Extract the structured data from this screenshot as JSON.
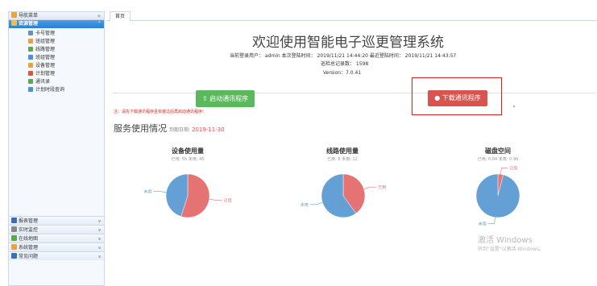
{
  "sidebar": {
    "header": "导航菜单",
    "active_group": "资源管理",
    "items": [
      {
        "label": "卡号管理",
        "color": "#6e8fbf"
      },
      {
        "label": "班组管理",
        "color": "#e8a33c"
      },
      {
        "label": "线路管理",
        "color": "#5ca84e"
      },
      {
        "label": "班组管理",
        "color": "#4f8fd6"
      },
      {
        "label": "设备管理",
        "color": "#e8a33c"
      },
      {
        "label": "计划管理",
        "color": "#d9534f"
      },
      {
        "label": "通讯录",
        "color": "#5ca84e"
      },
      {
        "label": "计划时段查询",
        "color": "#4f8fd6"
      }
    ],
    "bottom": [
      {
        "label": "报表管理",
        "color": "#3b6fb5"
      },
      {
        "label": "实时监控",
        "color": "#888888"
      },
      {
        "label": "在线地图",
        "color": "#5ca84e"
      },
      {
        "label": "系统管理",
        "color": "#e8a33c"
      },
      {
        "label": "常见问题",
        "color": "#3b6fb5"
      }
    ]
  },
  "tab": {
    "label": "首页"
  },
  "header": {
    "title": "欢迎使用智能电子巡更管理系统",
    "user_line": "当前登录用户： admin    本次登陆时间： 2019/11/21 14:44:20    最近登陆时间： 2019/11/21 14:43:57",
    "records_line": "巡检总记录数： 1598",
    "version_line": "Version：7.0.41"
  },
  "buttons": {
    "start": "启动通讯程序",
    "download": "下载通讯程序"
  },
  "note": "注：请先下载通讯程序且安装过后再启动通讯程序!",
  "section": {
    "title": "服务使用情况",
    "deadline_label": "到期日期:",
    "deadline_value": "2019-11-30"
  },
  "chart_data": [
    {
      "type": "pie",
      "title": "设备使用量",
      "subtitle": "已用: 55 未用: 45",
      "slices": [
        {
          "name": "已用",
          "value": 55,
          "color": "#e57373"
        },
        {
          "name": "未用",
          "value": 45,
          "color": "#64a0d6"
        }
      ]
    },
    {
      "type": "pie",
      "title": "线路使用量",
      "subtitle": "已用: 8 未用: 12",
      "slices": [
        {
          "name": "已用",
          "value": 8,
          "color": "#e57373"
        },
        {
          "name": "未用",
          "value": 12,
          "color": "#64a0d6"
        }
      ]
    },
    {
      "type": "pie",
      "title": "磁盘空间",
      "subtitle": "已用: 0.04 未用: 0.96",
      "slices": [
        {
          "name": "已用",
          "value": 0.04,
          "color": "#e57373"
        },
        {
          "name": "未用",
          "value": 0.96,
          "color": "#64a0d6"
        }
      ]
    }
  ],
  "watermark": {
    "line1": "激活 Windows",
    "line2": "转到\"设置\"以激活 Windows。"
  }
}
